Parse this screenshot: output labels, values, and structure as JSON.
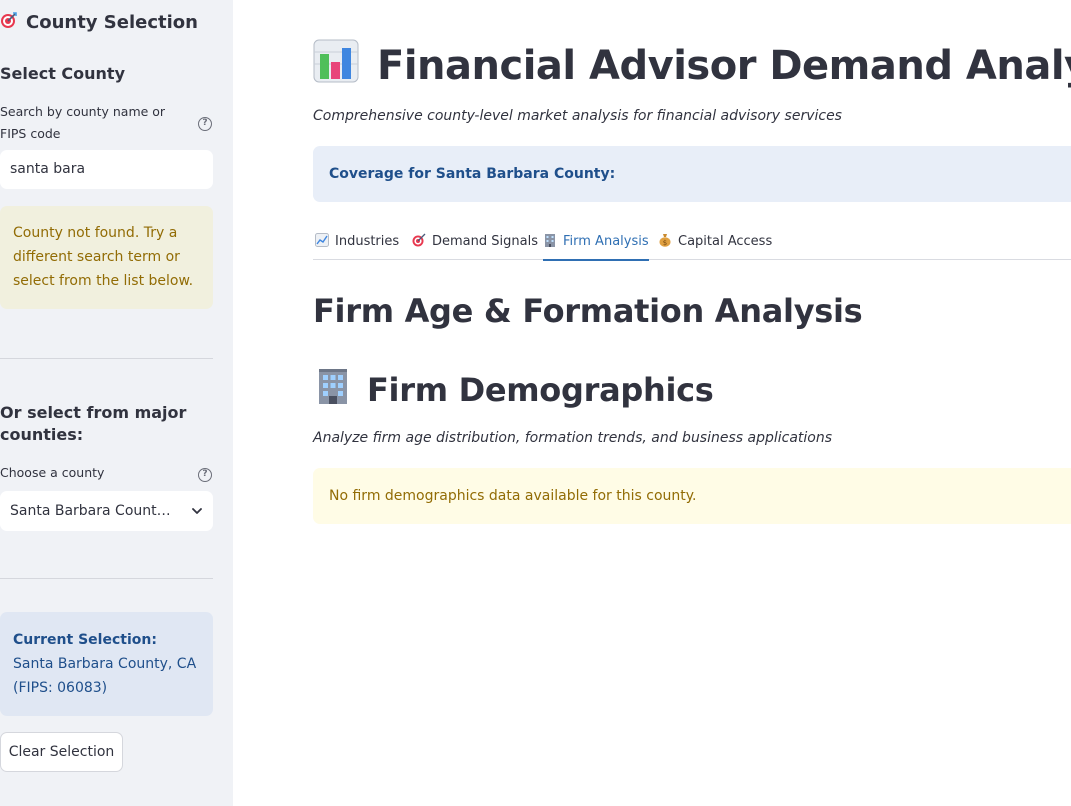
{
  "sidebar": {
    "title": "County Selection",
    "title_icon": "target-icon",
    "select_county_heading": "Select County",
    "search_label": "Search by county name or FIPS code",
    "search_value": "santa bara",
    "warning_text": "County not found. Try a different search term or select from the list below.",
    "major_heading": "Or select from major counties:",
    "choose_label": "Choose a county",
    "choose_value": "Santa Barbara County, CA",
    "current_selection_label": "Current Selection:",
    "current_selection_value": "Santa Barbara County, CA (FIPS: 06083)",
    "clear_button": "Clear Selection"
  },
  "main": {
    "title": "Financial Advisor Demand Analyzer",
    "title_icon": "bar-chart-icon",
    "subtitle": "Comprehensive county-level market analysis for financial advisory services",
    "coverage_text": "Coverage for Santa Barbara County:",
    "tabs": [
      {
        "label": "Industries",
        "icon": "chart-increasing-icon"
      },
      {
        "label": "Demand Signals",
        "icon": "target-icon"
      },
      {
        "label": "Firm Analysis",
        "icon": "office-building-icon"
      },
      {
        "label": "Capital Access",
        "icon": "money-bag-icon"
      }
    ],
    "active_tab": "Firm Analysis",
    "section_heading": "Firm Age & Formation Analysis",
    "subsection_heading": "Firm Demographics",
    "subsection_icon": "office-building-icon",
    "description": "Analyze firm age distribution, formation trends, and business applications",
    "no_data_message": "No firm demographics data available for this county."
  },
  "colors": {
    "sidebar_bg": "#f0f2f6",
    "accent_blue": "#2f6fb3",
    "info_text": "#1f4f8b",
    "warning_text": "#926c05"
  }
}
